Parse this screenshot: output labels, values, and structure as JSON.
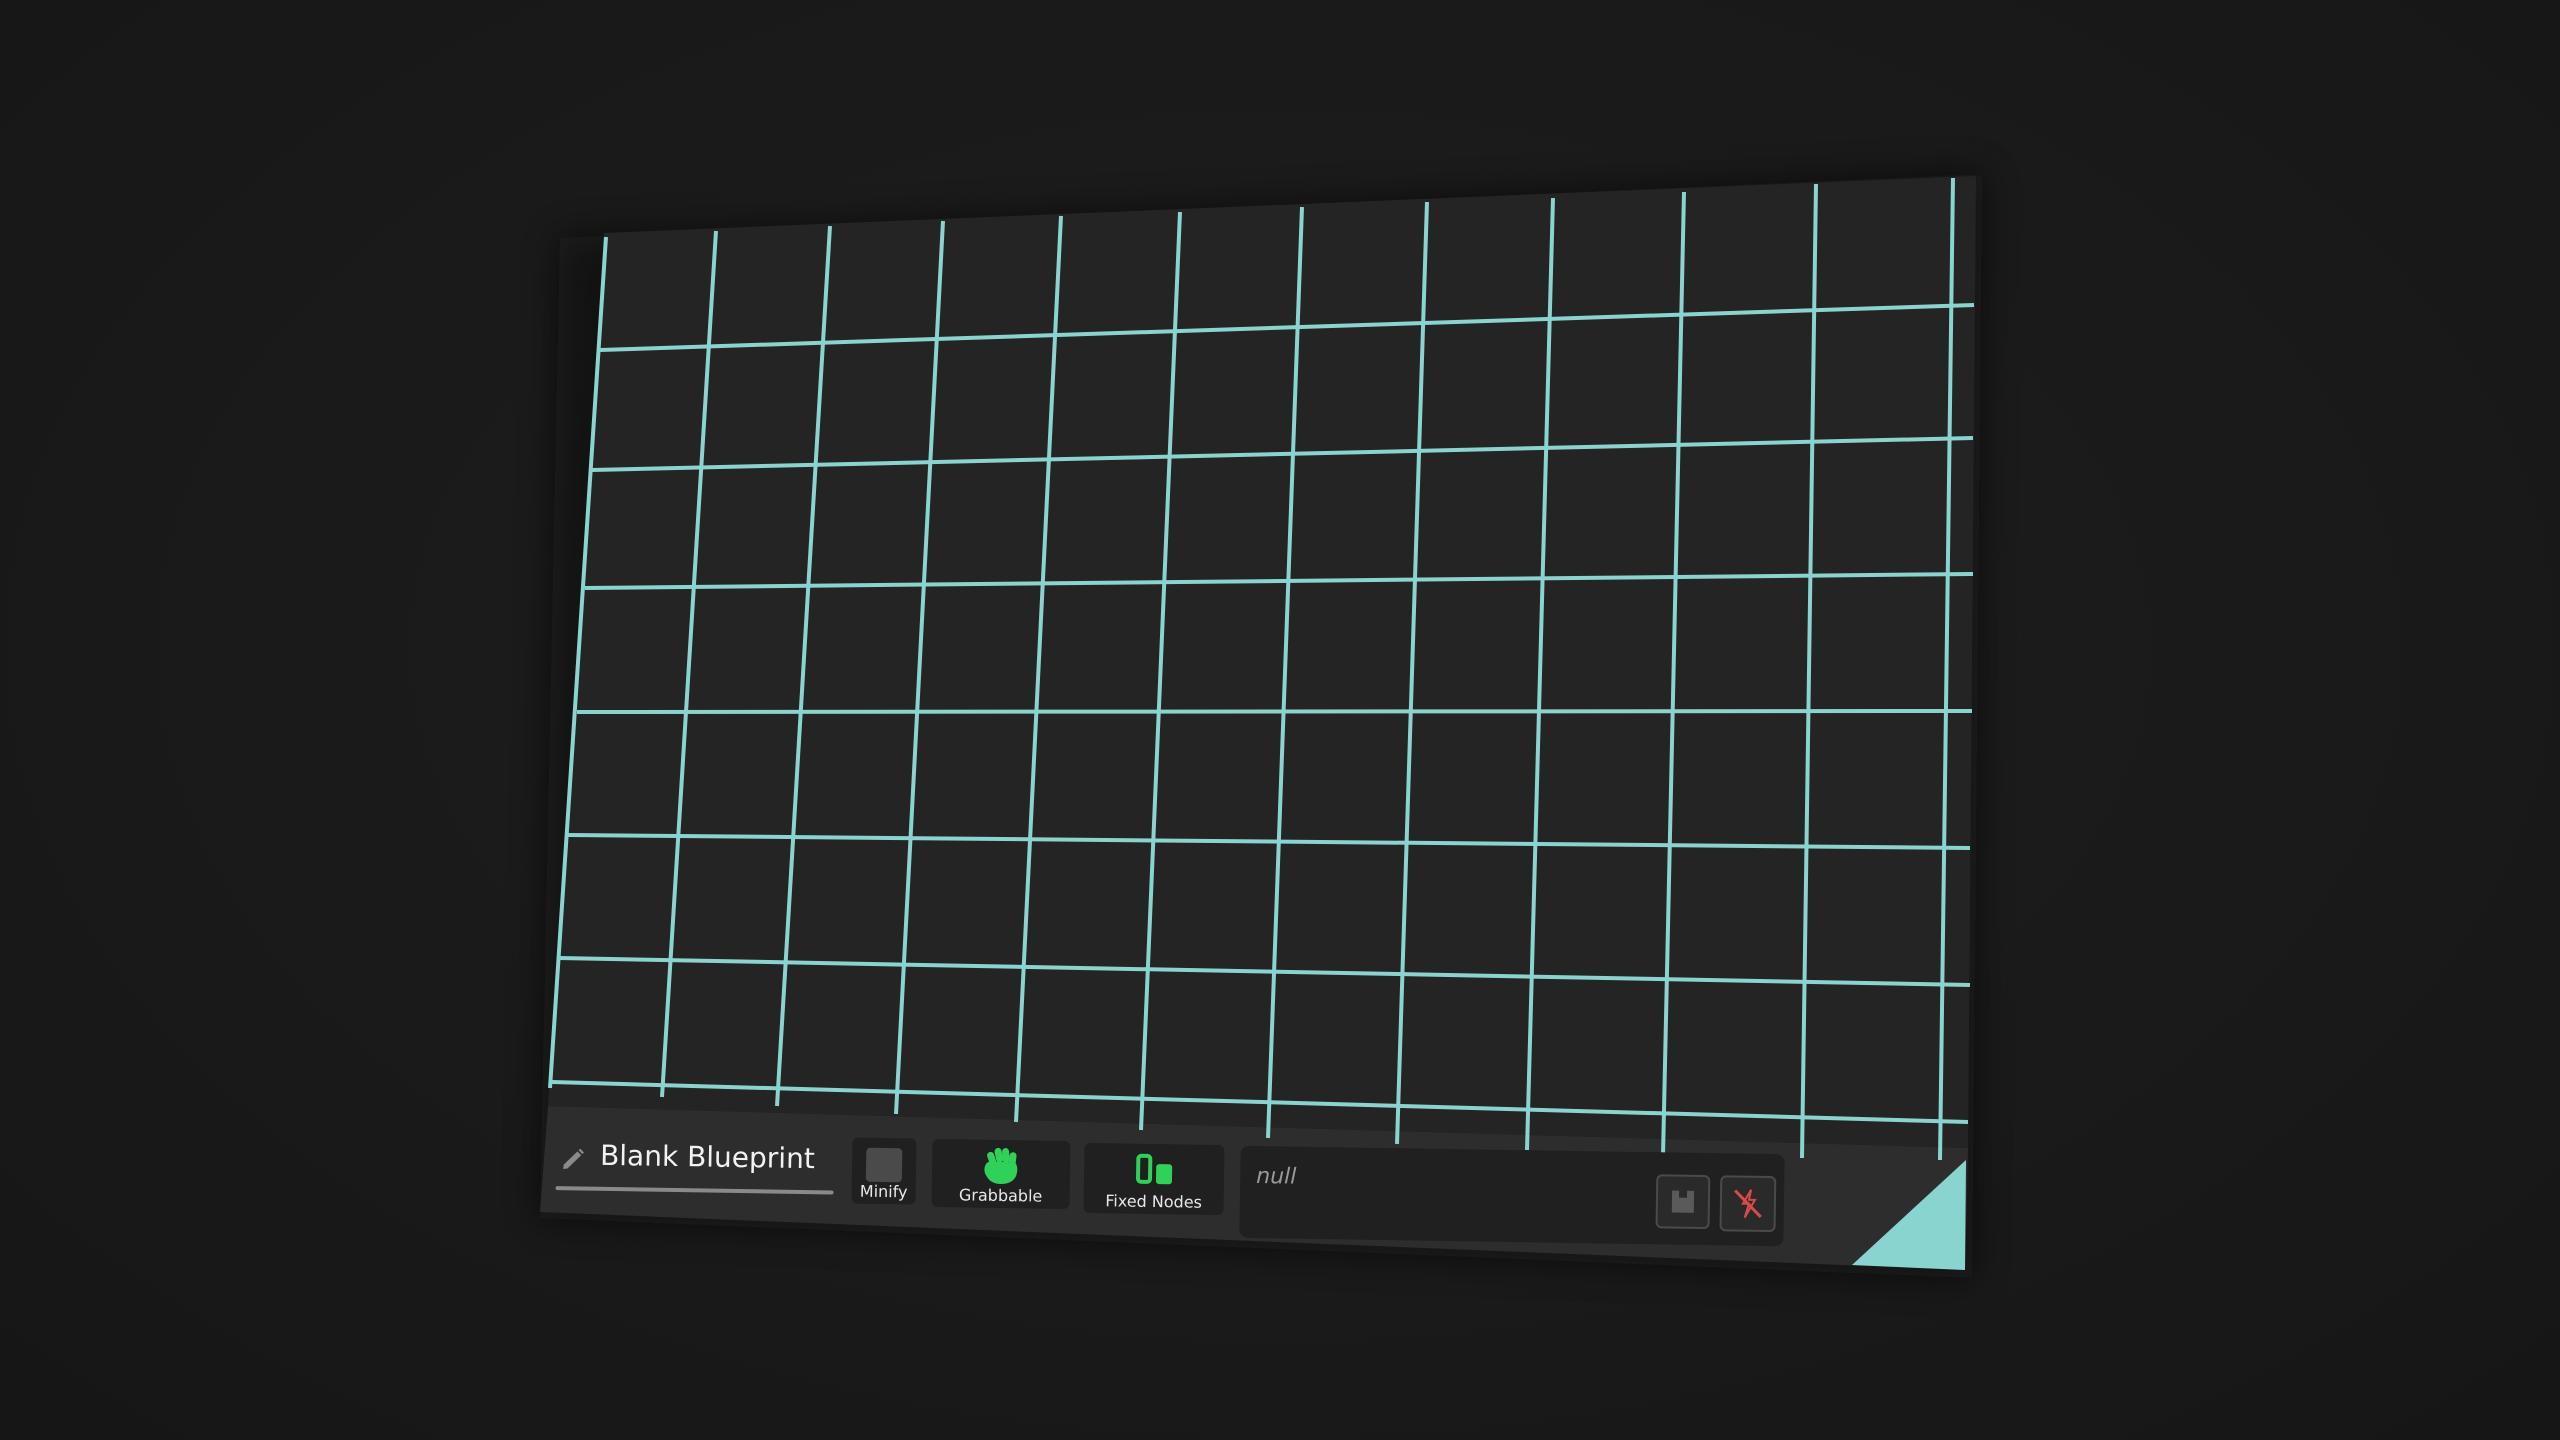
{
  "blueprint": {
    "name": "Blank Blueprint",
    "name_icon": "pencil-icon"
  },
  "toolbar": {
    "minify_label": "Minify",
    "grabbable_label": "Grabbable",
    "grabbable_icon": "fist-icon",
    "fixed_nodes_label": "Fixed Nodes",
    "fixed_nodes_icon": "fixed-nodes-icon",
    "reference_value": "null",
    "save_icon": "save-icon",
    "clear_icon": "clear-reference-icon"
  },
  "colors": {
    "grid_line": "#8ad4d0",
    "board": "#242424",
    "toolbar": "#2d2d2d",
    "accent_green": "#2fd158",
    "clear_red": "#d94a4a",
    "corner_accent": "#8ad4d0"
  }
}
